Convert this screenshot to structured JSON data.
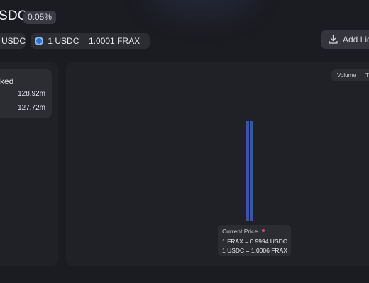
{
  "header": {
    "title": "SDC",
    "fee_tier": "0.05%"
  },
  "price_chips": {
    "token_chip": "USDC",
    "rate_chip": "1 USDC = 1.0001 FRAX"
  },
  "actions": {
    "add_liquidity_label": "Add Liqu"
  },
  "locked": {
    "title": "ked",
    "values": [
      "128.92m",
      "127.72m"
    ]
  },
  "chart": {
    "toggle_options": [
      "Volume",
      "T"
    ],
    "tooltip": {
      "label": "Current Price",
      "line1": "1 FRAX = 0.9994 USDC",
      "line2": "1 USDC = 1.0006 FRAX"
    }
  },
  "icons": {
    "coin": "usdc-coin-icon",
    "download": "download-icon"
  },
  "colors": {
    "background": "#1b1c21",
    "card": "#202126",
    "chip": "#2c2d33",
    "bar": "#3a54a8",
    "current_price_line": "#d74a6a",
    "accent_dot": "#e2456e"
  }
}
